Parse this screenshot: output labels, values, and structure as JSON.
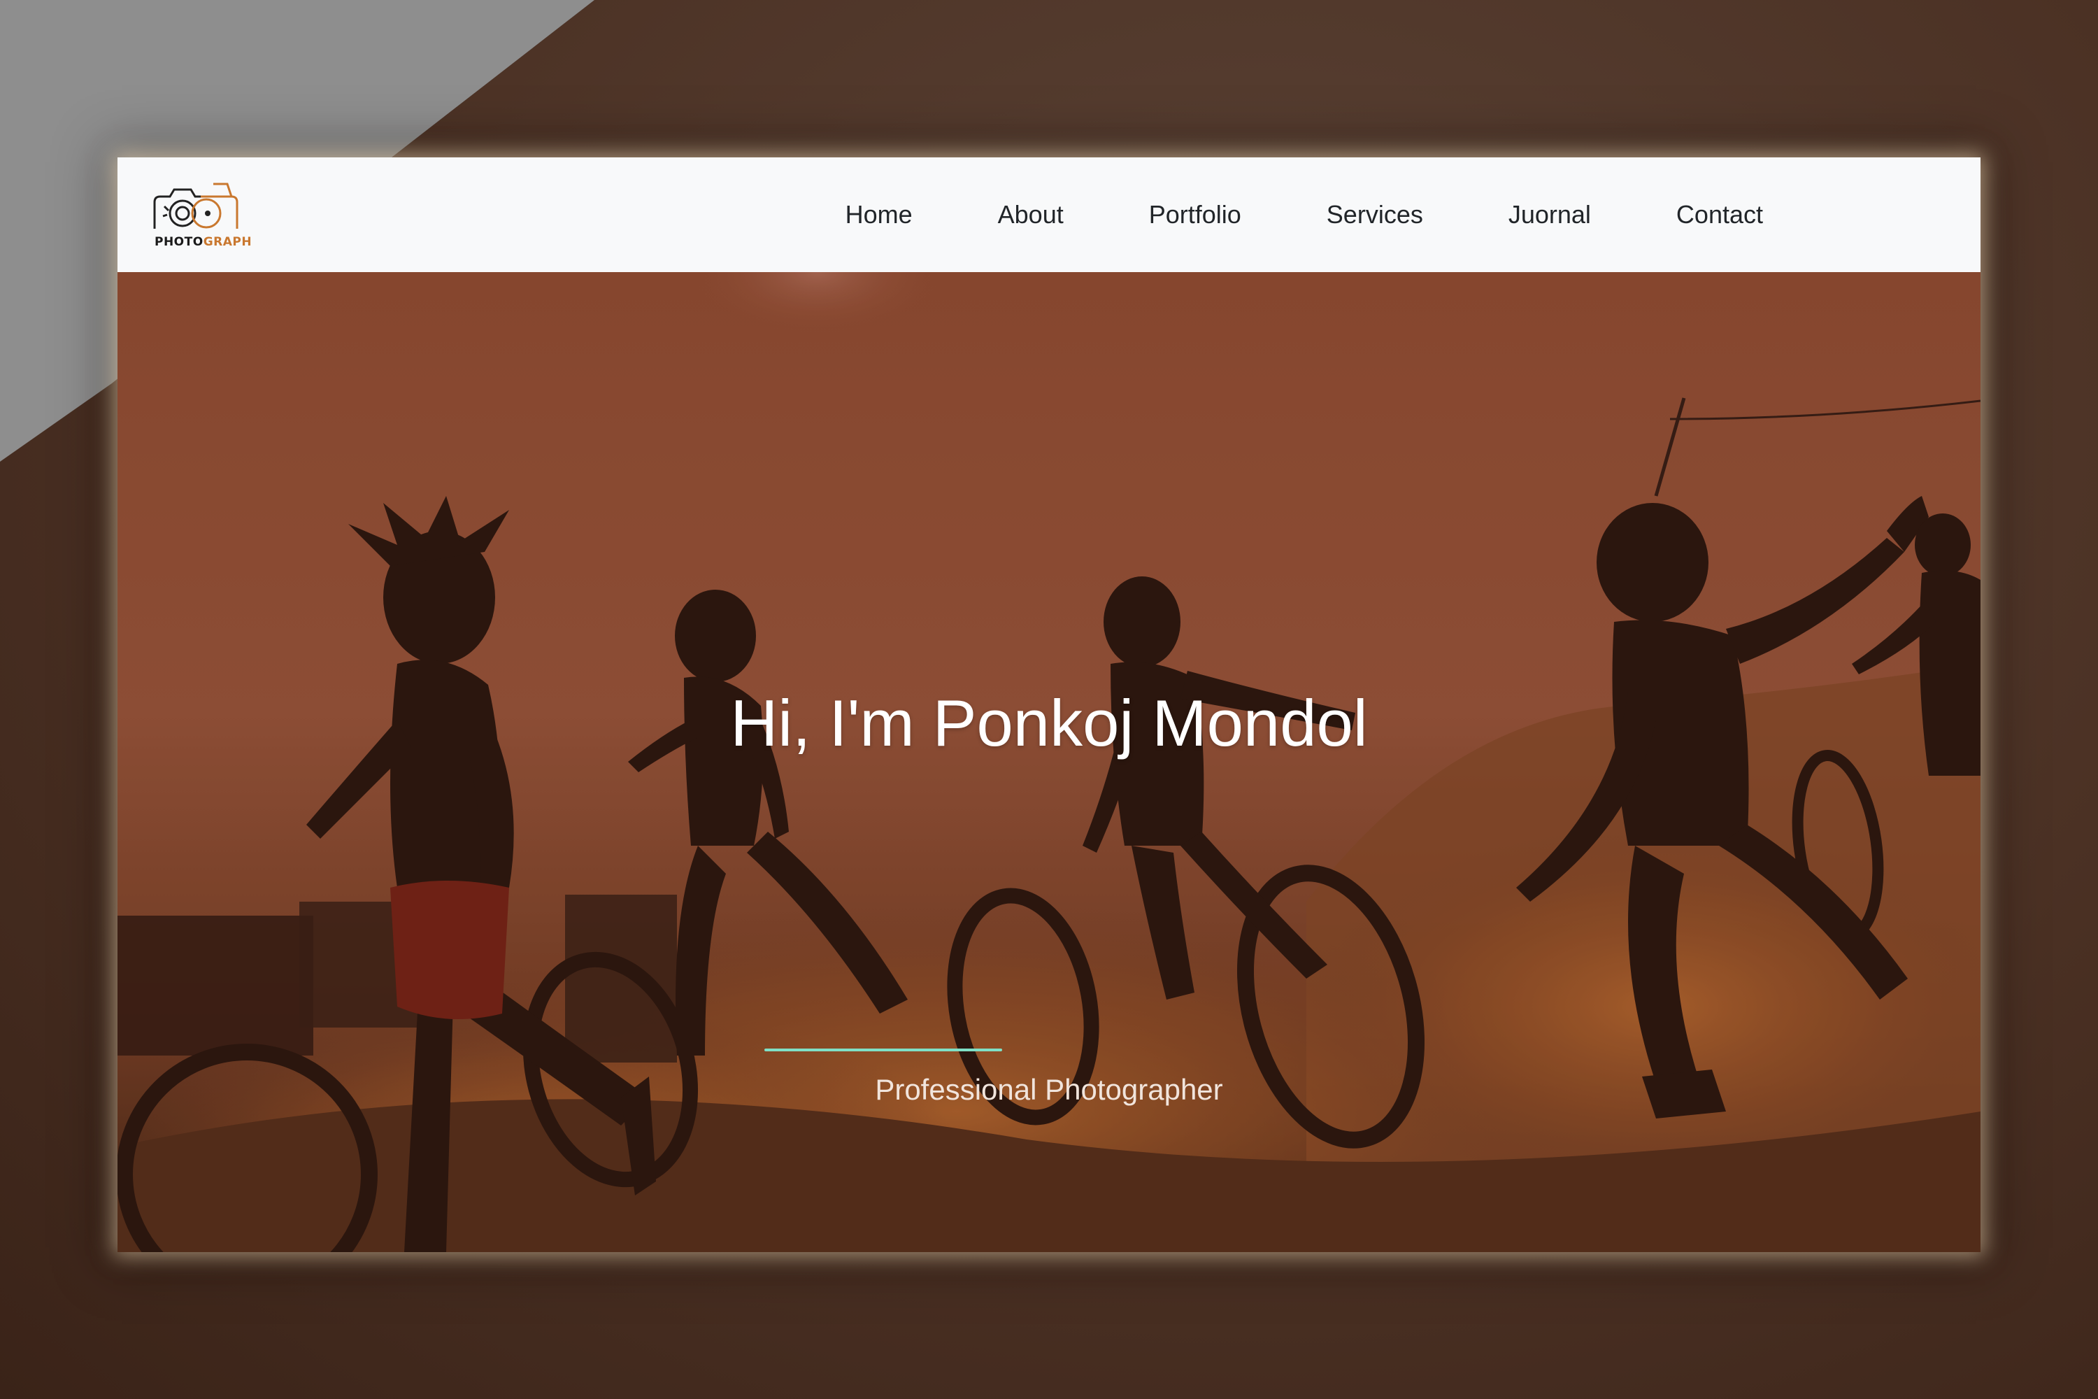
{
  "logo": {
    "text_prefix": "PHOTO",
    "text_accent": "GRAPH",
    "icon": "camera-icon",
    "accent_color": "#c9782f"
  },
  "nav": {
    "items": [
      {
        "label": "Home"
      },
      {
        "label": "About"
      },
      {
        "label": "Portfolio"
      },
      {
        "label": "Services"
      },
      {
        "label": "Juornal"
      },
      {
        "label": "Contact"
      }
    ]
  },
  "hero": {
    "title": "Hi, I'm Ponkoj Mondol",
    "subtitle": "Professional Photographer",
    "divider_color": "#7fe0c6",
    "image": "children-running-with-tires-silhouette"
  },
  "colors": {
    "navbar_bg": "#f8f9fa",
    "nav_text": "#212529",
    "hero_tint": "#8a4a30"
  }
}
